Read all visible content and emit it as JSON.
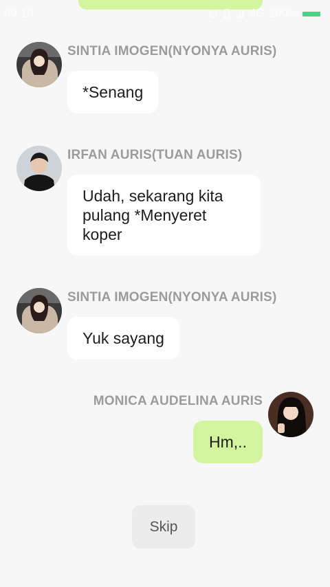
{
  "status_bar": {
    "time": "09.10",
    "network": "4G",
    "battery": "100%",
    "battery_color": "#2ecc71"
  },
  "messages": [
    {
      "sender": "SINTIA IMOGEN(NYONYA AURIS)",
      "text": "*Senang",
      "side": "left",
      "avatar": "avatar-woman-car"
    },
    {
      "sender": "IRFAN AURIS(TUAN AURIS)",
      "text": "Udah, sekarang kita pulang *Menyeret koper",
      "side": "left",
      "avatar": "avatar-man-dark"
    },
    {
      "sender": "SINTIA IMOGEN(NYONYA AURIS)",
      "text": "Yuk sayang",
      "side": "left",
      "avatar": "avatar-woman-car"
    },
    {
      "sender": "MONICA AUDELINA  AURIS",
      "text": "Hm,..",
      "side": "right",
      "avatar": "avatar-woman-black-hair"
    }
  ],
  "skip_label": "Skip",
  "colors": {
    "background": "#f7f7f7",
    "bubble_other": "#ffffff",
    "bubble_self": "#d4f5a0",
    "sender_text": "#9b9b9b"
  }
}
